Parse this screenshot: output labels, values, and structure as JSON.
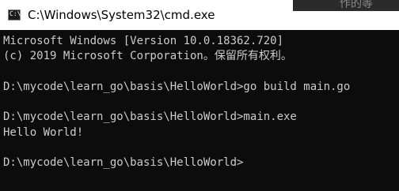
{
  "window": {
    "title": "C:\\Windows\\System32\\cmd.exe",
    "icon_name": "cmd-prompt-icon",
    "icon_glyph": "C:\\",
    "background_window_fragment": "作的等"
  },
  "console": {
    "lines": [
      "Microsoft Windows [Version 10.0.18362.720]",
      "(c) 2019 Microsoft Corporation。保留所有权利。",
      "",
      "D:\\mycode\\learn_go\\basis\\HelloWorld>go build main.go",
      "",
      "D:\\mycode\\learn_go\\basis\\HelloWorld>main.exe",
      "Hello World!",
      "",
      "D:\\mycode\\learn_go\\basis\\HelloWorld>"
    ]
  },
  "colors": {
    "console_bg": "#0c0c0c",
    "console_text": "#cccccc",
    "titlebar_bg": "#ffffff"
  }
}
